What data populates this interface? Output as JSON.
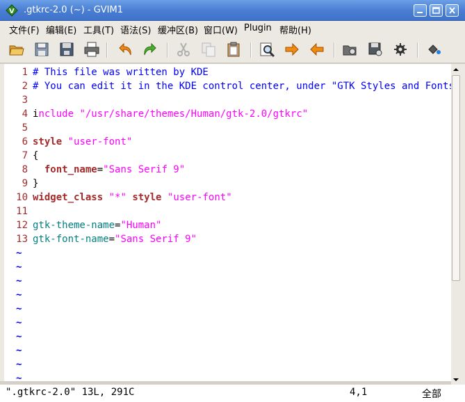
{
  "window": {
    "title": ".gtkrc-2.0 (~) - GVIM1"
  },
  "menu": [
    {
      "label": "文件(F)"
    },
    {
      "label": "编辑(E)"
    },
    {
      "label": "工具(T)"
    },
    {
      "label": "语法(S)"
    },
    {
      "label": "缓冲区(B)"
    },
    {
      "label": "窗口(W)"
    },
    {
      "label": "Plugin"
    },
    {
      "label": "帮助(H)"
    }
  ],
  "toolbar_icons": [
    "open-folder-icon",
    "save-icon",
    "save-all-icon",
    "print-icon",
    "undo-icon",
    "redo-icon",
    "cut-icon",
    "copy-icon",
    "paste-icon",
    "find-replace-icon",
    "find-next-icon",
    "find-prev-icon",
    "load-session-icon",
    "save-session-icon",
    "run-script-icon",
    "make-icon"
  ],
  "colors": {
    "comment": "#0000ff",
    "keyword": "#a52a2a",
    "string": "#ff00ff",
    "identifier": "#008080",
    "line_number": "#a52a2a"
  },
  "lines": [
    {
      "num": "1",
      "tokens": [
        {
          "t": "# This file was written by KDE",
          "c": "comment"
        }
      ]
    },
    {
      "num": "2",
      "tokens": [
        {
          "t": "# You can edit it in the KDE control center, under \"GTK Styles and Fonts\"",
          "c": "comment"
        }
      ]
    },
    {
      "num": "3",
      "tokens": []
    },
    {
      "num": "4",
      "tokens": [
        {
          "t": "i",
          "c": "cursor"
        },
        {
          "t": "nclude ",
          "c": "string"
        },
        {
          "t": "\"/usr/share/themes/Human/gtk-2.0/gtkrc\"",
          "c": "string"
        }
      ]
    },
    {
      "num": "5",
      "tokens": []
    },
    {
      "num": "6",
      "tokens": [
        {
          "t": "style",
          "c": "keyword"
        },
        {
          "t": " ",
          "c": "plain"
        },
        {
          "t": "\"user-font\"",
          "c": "string"
        }
      ]
    },
    {
      "num": "7",
      "tokens": [
        {
          "t": "{",
          "c": "plain"
        }
      ]
    },
    {
      "num": "8",
      "tokens": [
        {
          "t": "  ",
          "c": "plain"
        },
        {
          "t": "font_name",
          "c": "keyword"
        },
        {
          "t": "=",
          "c": "plain"
        },
        {
          "t": "\"Sans Serif 9\"",
          "c": "string"
        }
      ]
    },
    {
      "num": "9",
      "tokens": [
        {
          "t": "}",
          "c": "plain"
        }
      ]
    },
    {
      "num": "10",
      "tokens": [
        {
          "t": "widget_class",
          "c": "keyword"
        },
        {
          "t": " ",
          "c": "plain"
        },
        {
          "t": "\"*\"",
          "c": "string"
        },
        {
          "t": " ",
          "c": "plain"
        },
        {
          "t": "style",
          "c": "keyword"
        },
        {
          "t": " ",
          "c": "plain"
        },
        {
          "t": "\"user-font\"",
          "c": "string"
        }
      ]
    },
    {
      "num": "11",
      "tokens": []
    },
    {
      "num": "12",
      "tokens": [
        {
          "t": "gtk-theme-name",
          "c": "func"
        },
        {
          "t": "=",
          "c": "plain"
        },
        {
          "t": "\"Human\"",
          "c": "string"
        }
      ]
    },
    {
      "num": "13",
      "tokens": [
        {
          "t": "gtk-font-name",
          "c": "func"
        },
        {
          "t": "=",
          "c": "plain"
        },
        {
          "t": "\"Sans Serif 9\"",
          "c": "string"
        }
      ]
    }
  ],
  "tilde": "~",
  "tilde_count": 10,
  "status": {
    "file_info": "\".gtkrc-2.0\" 13L, 291C",
    "position": "4,1",
    "scroll": "全部"
  }
}
